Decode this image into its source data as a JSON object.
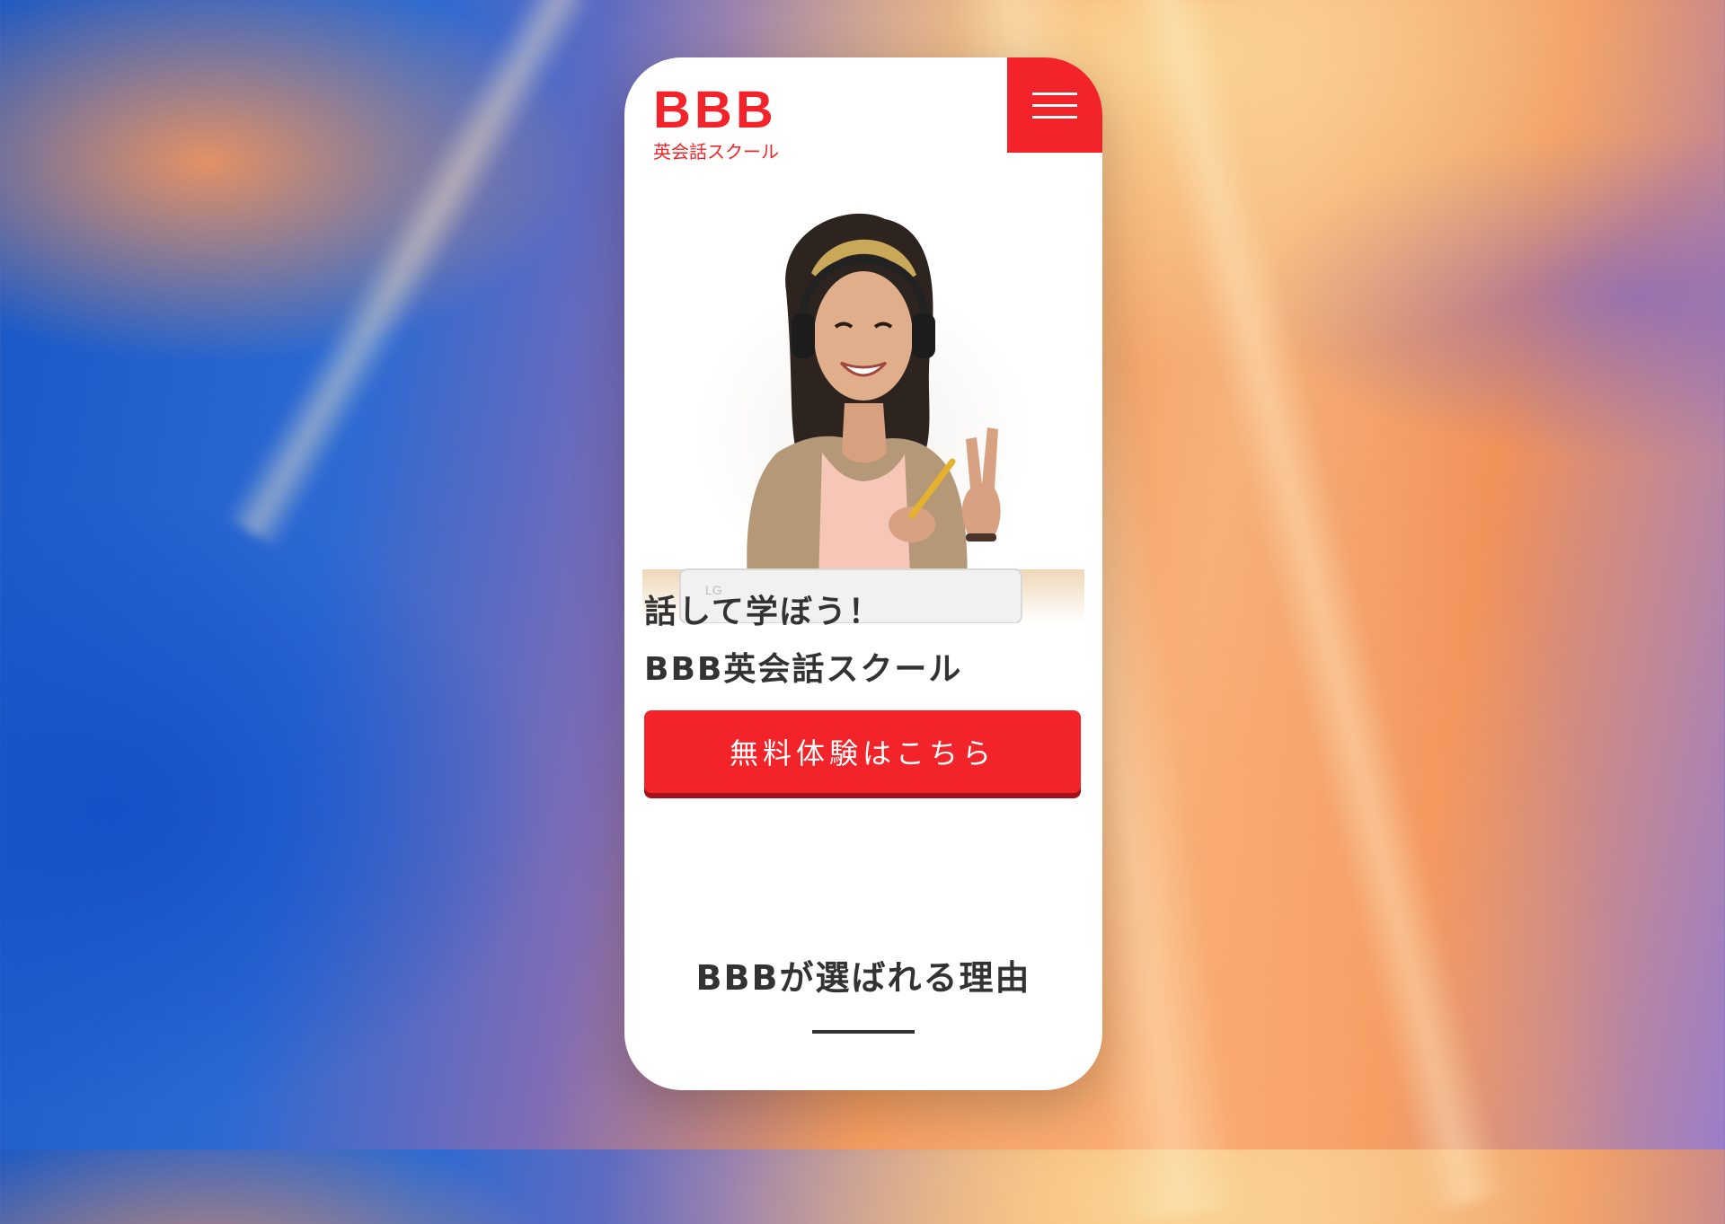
{
  "header": {
    "logo_main": "BBB",
    "logo_sub": "英会話スクール",
    "menu_icon": "hamburger-menu-icon"
  },
  "hero": {
    "image_alt": "smiling woman with headphones holding a pencil and making a peace sign"
  },
  "headline": {
    "line1": "話して学ぼう！",
    "line2": "BBB英会話スクール"
  },
  "cta": {
    "label": "無料体験はこちら"
  },
  "section": {
    "title": "BBBが選ばれる理由"
  },
  "colors": {
    "brand_red": "#f2242a",
    "cta_shadow": "#a5121b",
    "text_dark": "#333333"
  }
}
